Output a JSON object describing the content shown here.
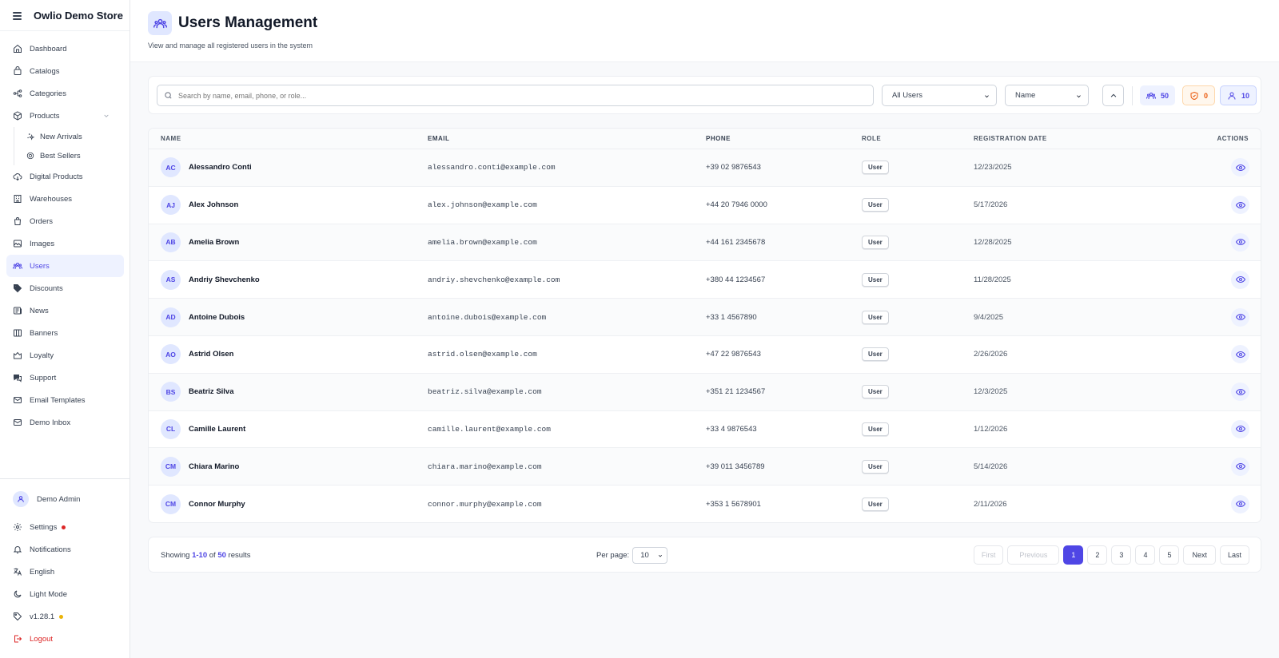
{
  "app": {
    "store_name": "Owlio Demo Store"
  },
  "sidebar": {
    "items": [
      {
        "label": "Dashboard",
        "icon": "home-icon"
      },
      {
        "label": "Catalogs",
        "icon": "catalog-icon"
      },
      {
        "label": "Categories",
        "icon": "categories-icon"
      },
      {
        "label": "Products",
        "icon": "box-icon",
        "expanded": true
      },
      {
        "label": "Digital Products",
        "icon": "cloud-icon"
      },
      {
        "label": "Warehouses",
        "icon": "warehouse-icon"
      },
      {
        "label": "Orders",
        "icon": "bag-icon"
      },
      {
        "label": "Images",
        "icon": "image-icon"
      },
      {
        "label": "Users",
        "icon": "users-icon",
        "active": true
      },
      {
        "label": "Discounts",
        "icon": "tag-icon"
      },
      {
        "label": "News",
        "icon": "news-icon"
      },
      {
        "label": "Banners",
        "icon": "banner-icon"
      },
      {
        "label": "Loyalty",
        "icon": "loyalty-icon"
      },
      {
        "label": "Support",
        "icon": "support-icon"
      },
      {
        "label": "Email Templates",
        "icon": "mail-icon"
      },
      {
        "label": "Demo Inbox",
        "icon": "inbox-icon"
      }
    ],
    "sub_items": [
      {
        "label": "New Arrivals",
        "icon": "sparkle-icon"
      },
      {
        "label": "Best Sellers",
        "icon": "award-icon"
      }
    ],
    "bottom": {
      "user": "Demo Admin",
      "settings": "Settings",
      "notifications": "Notifications",
      "language": "English",
      "theme": "Light Mode",
      "version": "v1.28.1",
      "logout": "Logout"
    }
  },
  "header": {
    "title": "Users Management",
    "subtitle": "View and manage all registered users in the system"
  },
  "filters": {
    "search_placeholder": "Search by name, email, phone, or role...",
    "user_filter": "All Users",
    "sort_field": "Name",
    "stats": {
      "total": "50",
      "admins": "0",
      "users": "10"
    }
  },
  "table": {
    "columns": {
      "name": "NAME",
      "email": "EMAIL",
      "phone": "PHONE",
      "role": "ROLE",
      "date": "REGISTRATION DATE",
      "actions": "ACTIONS"
    },
    "rows": [
      {
        "initials": "AC",
        "name": "Alessandro Conti",
        "email": "alessandro.conti@example.com",
        "phone": "+39 02 9876543",
        "role": "User",
        "date": "12/23/2025"
      },
      {
        "initials": "AJ",
        "name": "Alex Johnson",
        "email": "alex.johnson@example.com",
        "phone": "+44 20 7946 0000",
        "role": "User",
        "date": "5/17/2026"
      },
      {
        "initials": "AB",
        "name": "Amelia Brown",
        "email": "amelia.brown@example.com",
        "phone": "+44 161 2345678",
        "role": "User",
        "date": "12/28/2025"
      },
      {
        "initials": "AS",
        "name": "Andriy Shevchenko",
        "email": "andriy.shevchenko@example.com",
        "phone": "+380 44 1234567",
        "role": "User",
        "date": "11/28/2025"
      },
      {
        "initials": "AD",
        "name": "Antoine Dubois",
        "email": "antoine.dubois@example.com",
        "phone": "+33 1 4567890",
        "role": "User",
        "date": "9/4/2025"
      },
      {
        "initials": "AO",
        "name": "Astrid Olsen",
        "email": "astrid.olsen@example.com",
        "phone": "+47 22 9876543",
        "role": "User",
        "date": "2/26/2026"
      },
      {
        "initials": "BS",
        "name": "Beatriz Silva",
        "email": "beatriz.silva@example.com",
        "phone": "+351 21 1234567",
        "role": "User",
        "date": "12/3/2025"
      },
      {
        "initials": "CL",
        "name": "Camille Laurent",
        "email": "camille.laurent@example.com",
        "phone": "+33 4 9876543",
        "role": "User",
        "date": "1/12/2026"
      },
      {
        "initials": "CM",
        "name": "Chiara Marino",
        "email": "chiara.marino@example.com",
        "phone": "+39 011 3456789",
        "role": "User",
        "date": "5/14/2026"
      },
      {
        "initials": "CM",
        "name": "Connor Murphy",
        "email": "connor.murphy@example.com",
        "phone": "+353 1 5678901",
        "role": "User",
        "date": "2/11/2026"
      }
    ]
  },
  "pagination": {
    "showing_prefix": "Showing",
    "range": "1-10",
    "of": "of",
    "total": "50",
    "suffix": "results",
    "per_page_label": "Per page:",
    "per_page": "10",
    "first": "First",
    "previous": "Previous",
    "pages": [
      "1",
      "2",
      "3",
      "4",
      "5"
    ],
    "current_page": "1",
    "next": "Next",
    "last": "Last"
  },
  "colors": {
    "accent": "#4f46e5",
    "accent_light": "#eef2ff",
    "danger": "#dc2626",
    "warning": "#ea580c"
  }
}
